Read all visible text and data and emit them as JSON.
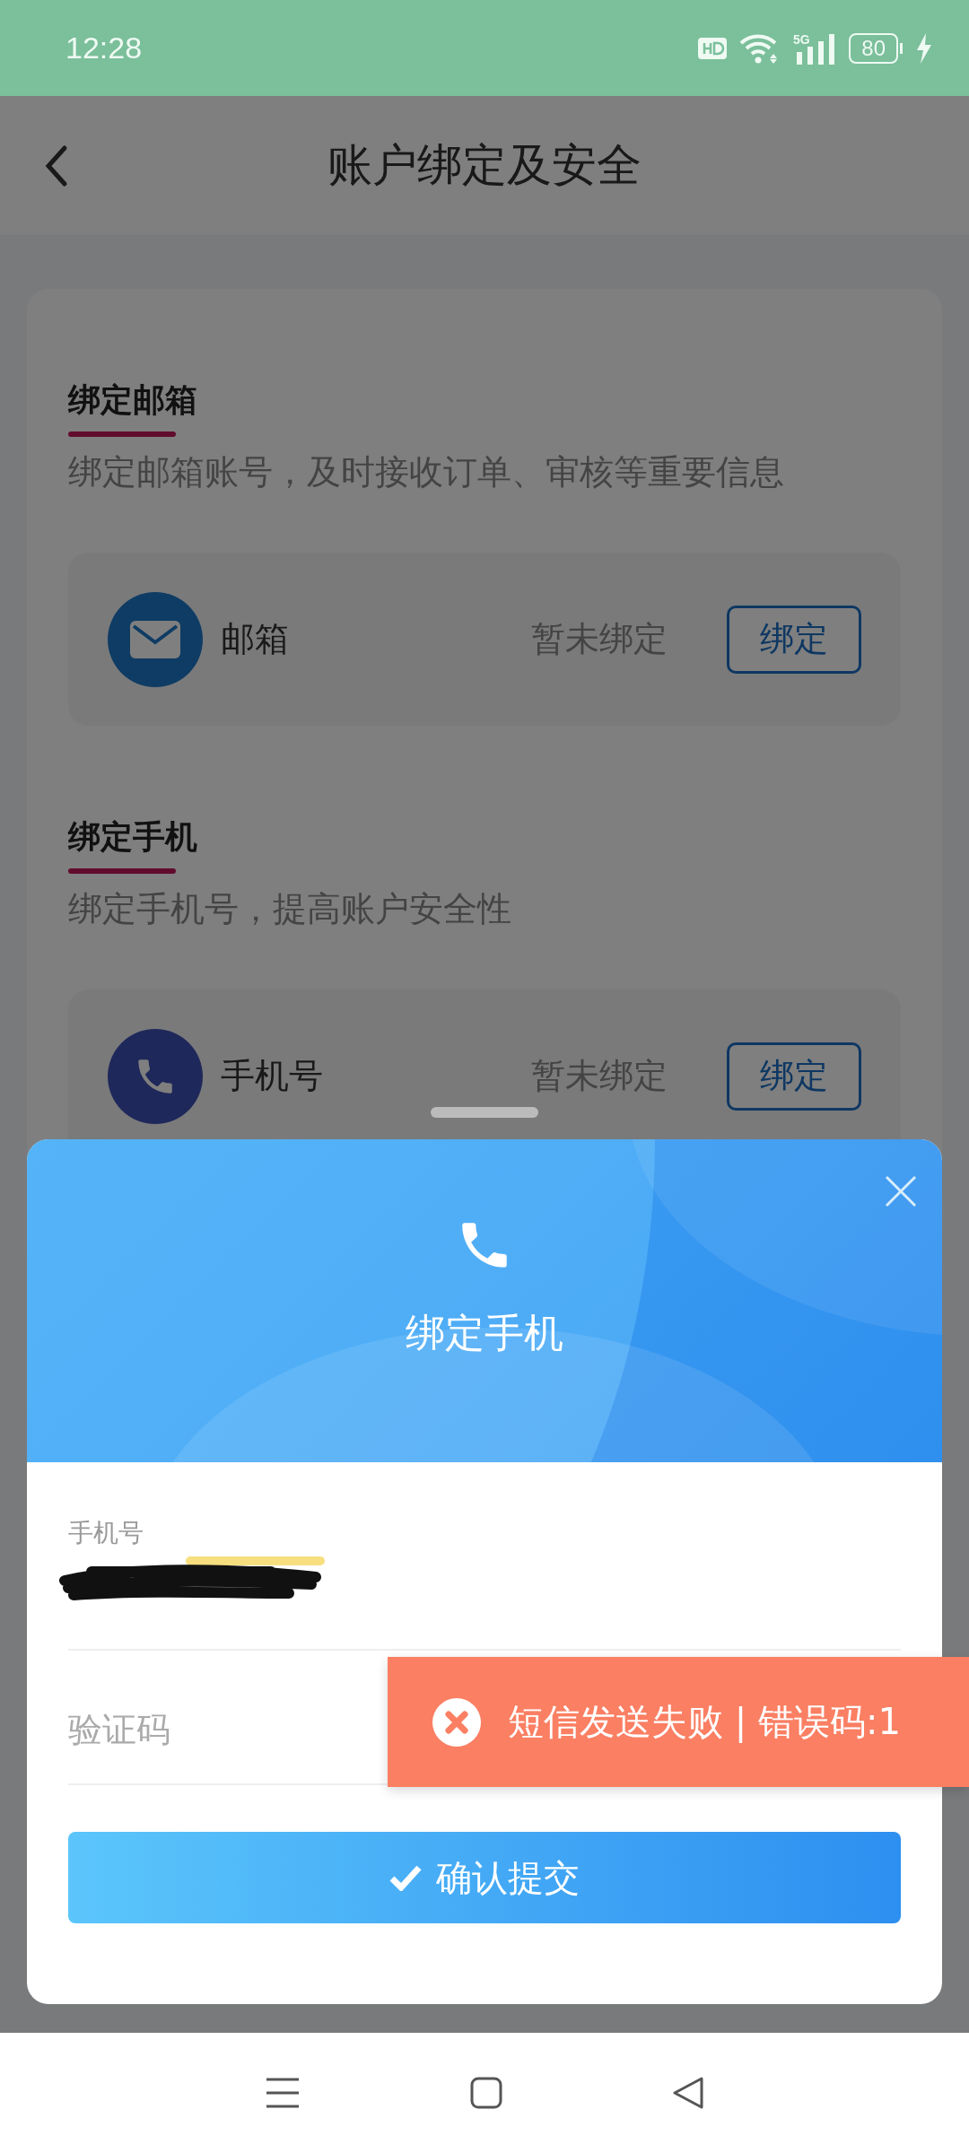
{
  "status_bar": {
    "time": "12:28",
    "network": "5G",
    "battery": "80"
  },
  "header": {
    "title": "账户绑定及安全"
  },
  "sections": [
    {
      "kind": "email",
      "title": "绑定邮箱",
      "description": "绑定邮箱账号，及时接收订单、审核等重要信息",
      "account": {
        "label": "邮箱",
        "status": "暂未绑定",
        "action": "绑定"
      }
    },
    {
      "kind": "phone",
      "title": "绑定手机",
      "description": "绑定手机号，提高账户安全性",
      "account": {
        "label": "手机号",
        "status": "暂未绑定",
        "action": "绑定"
      }
    }
  ],
  "sheet": {
    "title": "绑定手机",
    "fields": [
      {
        "kind": "redacted",
        "label": "手机号"
      },
      {
        "kind": "code",
        "placeholder": "验证码"
      }
    ],
    "submit": {
      "label": "确认提交"
    }
  },
  "toast": {
    "message": "短信发送失败 | 错误码:1"
  }
}
